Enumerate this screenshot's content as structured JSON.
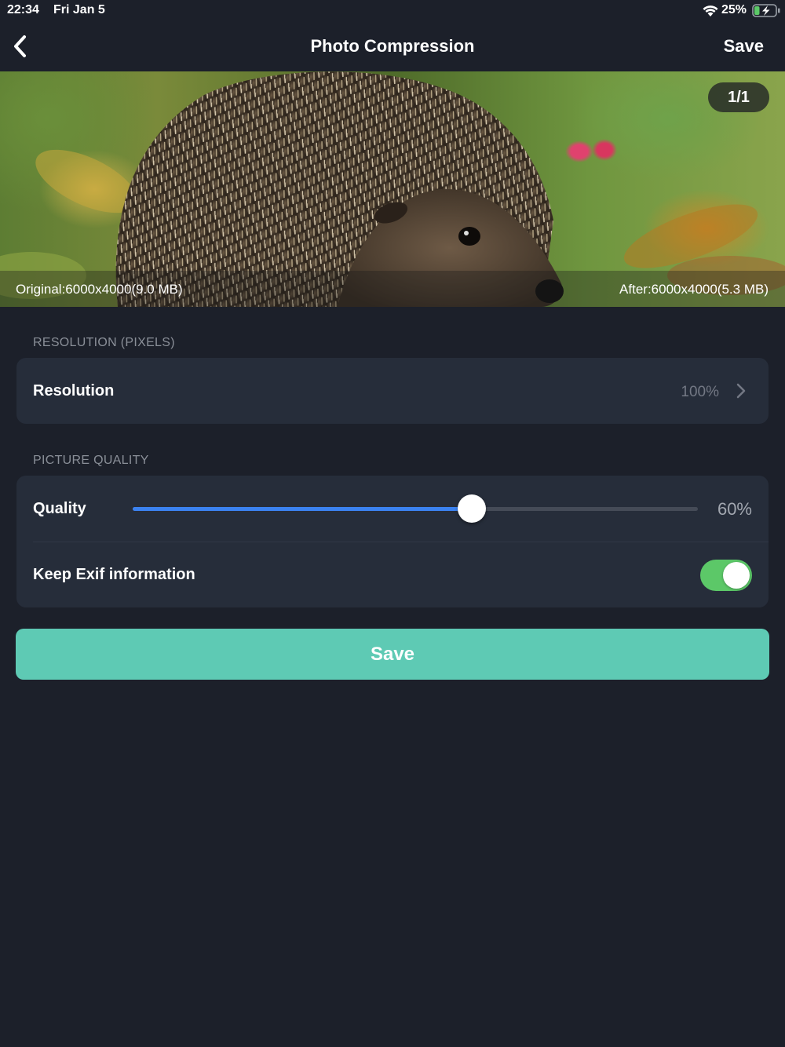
{
  "status_bar": {
    "time": "22:34",
    "date": "Fri Jan 5",
    "battery_percent": "25%",
    "battery_level": 0.25,
    "charging": true,
    "icons": [
      "wifi-icon",
      "battery-charging-icon"
    ]
  },
  "nav": {
    "back_icon": "chevron-left-icon",
    "title": "Photo Compression",
    "save_label": "Save"
  },
  "photo": {
    "subject": "hedgehog",
    "counter": "1/1",
    "original_info": "Original:6000x4000(9.0 MB)",
    "after_info": "After:6000x4000(5.3 MB)"
  },
  "resolution_section": {
    "header": "RESOLUTION (PIXELS)",
    "label": "Resolution",
    "value": "100%",
    "icon": "chevron-right-icon"
  },
  "quality_section": {
    "header": "PICTURE QUALITY",
    "quality_label": "Quality",
    "quality_value": "60%",
    "quality_level": 0.6,
    "exif_label": "Keep Exif information",
    "exif_enabled": true
  },
  "save_button_label": "Save",
  "colors": {
    "background": "#1c202a",
    "card": "#262d3a",
    "accent_blue": "#3b82f0",
    "toggle_green": "#5cc868",
    "save_teal": "#5ecab4"
  }
}
